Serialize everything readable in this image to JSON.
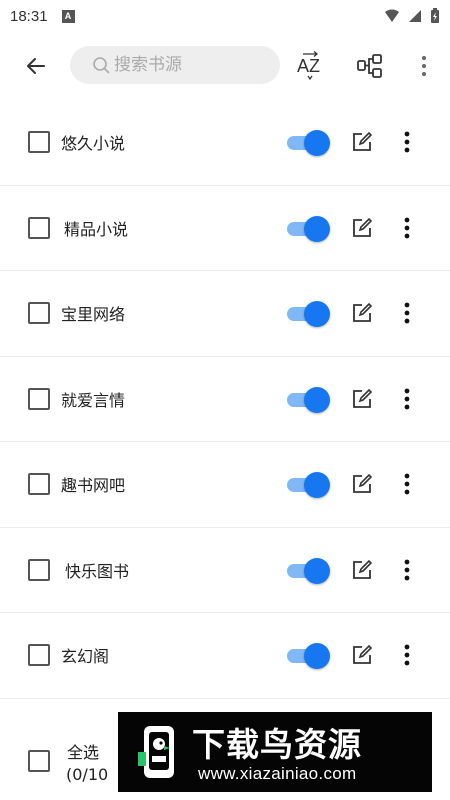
{
  "status_bar": {
    "time": "18:31",
    "notification_icon": "A"
  },
  "toolbar": {
    "search_placeholder": "搜索书源",
    "sort_label": "A/Z sort",
    "icons": [
      "back-arrow-icon",
      "search-icon",
      "sort-az-icon",
      "group-icon",
      "more-vert-icon"
    ]
  },
  "sources": {
    "items": [
      {
        "label": "悠久小说",
        "enabled": true,
        "checked": false
      },
      {
        "label": "精品小说",
        "enabled": true,
        "checked": false
      },
      {
        "label": "宝里网络",
        "enabled": true,
        "checked": false
      },
      {
        "label": "就爱言情",
        "enabled": true,
        "checked": false
      },
      {
        "label": "趣书网吧",
        "enabled": true,
        "checked": false
      },
      {
        "label": "快乐图书",
        "enabled": true,
        "checked": false
      },
      {
        "label": "玄幻阁",
        "enabled": true,
        "checked": false
      }
    ]
  },
  "footer": {
    "select_all_label": "全选",
    "select_count": "(0/10"
  },
  "watermark": {
    "title": "下载鸟资源",
    "url": "www.xiazainiao.com"
  },
  "colors": {
    "accent": "#1677f0",
    "toggle_track": "#80b8f5",
    "search_bg": "#eeeeee"
  }
}
